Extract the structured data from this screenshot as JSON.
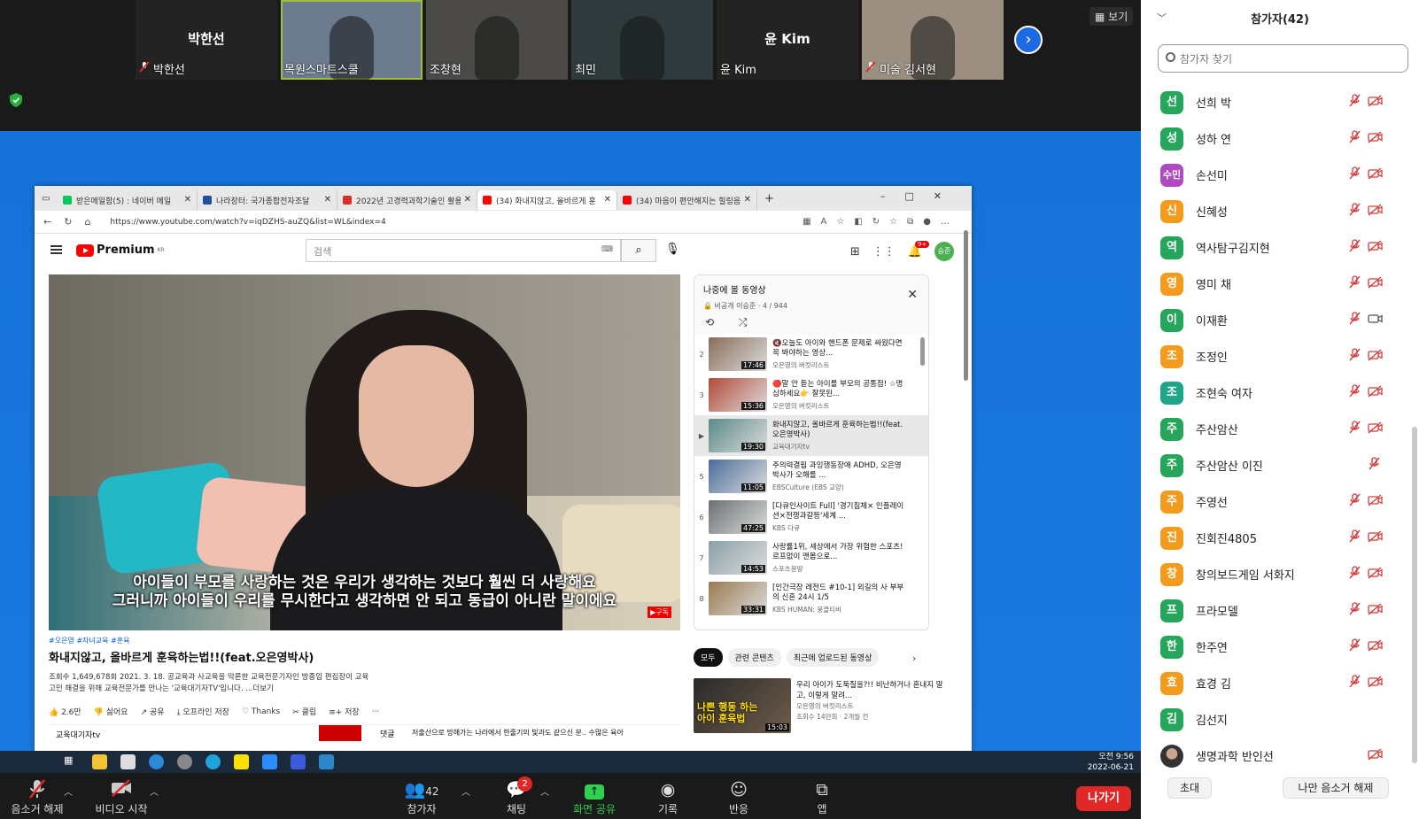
{
  "videos": [
    {
      "name": "박한선",
      "label": "박한선",
      "big": true,
      "mic_off": true,
      "bg": "#232323"
    },
    {
      "name": "목원스마트스쿨",
      "label": "목원스마트스쿨",
      "active": true,
      "bg": "#6c7b8e"
    },
    {
      "name": "조창현",
      "label": "조창현",
      "bg": "#4b4a48"
    },
    {
      "name": "최민",
      "label": "최민",
      "bg": "#2f3a3c"
    },
    {
      "name": "윤 Kim",
      "label": "윤 Kim",
      "big": true,
      "bg": "#232323"
    },
    {
      "name": "미술 김서현",
      "label": "미술 김서현",
      "mic_off": true,
      "bg": "#9a8f80"
    }
  ],
  "view_label": "보기",
  "next_icon": "chevron-right-icon",
  "browser": {
    "tabs": [
      {
        "title": "받은메일함(5) : 네이버 메일",
        "color": "#03c75a"
      },
      {
        "title": "나라장터: 국가종합전자조달",
        "color": "#1d4f9c"
      },
      {
        "title": "2022년 고경력과학기술인 활용",
        "color": "#d93025"
      },
      {
        "title": "(34) 화내지않고, 올바르게 훈",
        "color": "#ff0000",
        "active": true
      },
      {
        "title": "(34) 마음이 편안해지는 힐링음",
        "color": "#ff0000"
      }
    ],
    "new_tab": "+",
    "window_controls": "–□✕",
    "url": "https://www.youtube.com/watch?v=iqDZHS-auZQ&list=WL&index=4"
  },
  "youtube": {
    "logo": "Premium",
    "logo_region": "KR",
    "search_placeholder": "검색",
    "notif_count": "9+",
    "user_initial": "승준",
    "subtitle_line1": "아이들이 부모를 사랑하는 것은 우리가 생각하는 것보다 훨씬 더 사랑해요",
    "subtitle_line2": "그러니까 아이들이 우리를 무시한다고 생각하면 안 되고 동급이 아니란 말이에요",
    "sub_logo": "▶구독",
    "tags": "#오은영 #자녀교육 #훈육",
    "title": "화내지않고, 올바르게 훈육하는법!!(feat.오은영박사)",
    "meta_line1": "조회수 1,649,678회  2021. 3. 18.  공교육과 사교육을 막론한 교육전문기자인 방종임 편집장이 교육",
    "meta_line2": "고민 해결을 위해 교육전문가를 만나는 '교육대기자TV'입니다.   ...더보기",
    "actions": [
      "👍 2.6만",
      "👎 싫어요",
      "↗ 공유",
      "⤓ 오프라인 저장",
      "♡ Thanks",
      "✂ 클립",
      "≡+ 저장",
      "···"
    ],
    "channel": "교육대기자tv",
    "comment_label": "댓글",
    "comment_preview": "저출산으로 망해가는 나라에서 한줄기의 빛과도 같으신 분.. 수많은 육아",
    "playlist": {
      "title": "나중에 볼 동영상",
      "meta": "🔒 비공개   이승준 · 4 / 944",
      "controls": "⟲ ⤮",
      "items": [
        {
          "num": "2",
          "title": "🔇오늘도 아이와 핸드폰 문제로 싸웠다면 꼭 봐야하는 영상...",
          "channel": "오은영의 버킷리스트",
          "dur": "17:46",
          "color": "#8a6d5a"
        },
        {
          "num": "3",
          "title": "🔴말 안 듣는 아이를 부모의 공통점! ☆명심하세요👉 잘못된...",
          "channel": "오은영의 버킷리스트",
          "dur": "15:36",
          "color": "#b24a3a"
        },
        {
          "num": "▶",
          "title": "화내지않고, 올바르게 훈육하는법!!(feat.오은영박사)",
          "channel": "교육대기자tv",
          "dur": "19:30",
          "color": "#5a8a88",
          "cur": true
        },
        {
          "num": "5",
          "title": "주의력결핍 과잉행동장애 ADHD, 오은영 박사가 오해를 ...",
          "channel": "EBSCulture (EBS 교양)",
          "dur": "11:05",
          "color": "#4a6c9a"
        },
        {
          "num": "6",
          "title": "[다큐인사이트 Full] '경기침체× 인플레이션×전쟁과갈등'세계 ...",
          "channel": "KBS 다큐",
          "dur": "47:25",
          "color": "#6a7070"
        },
        {
          "num": "7",
          "title": "사랑률1위, 세상에서 가장 위험한 스포츠! 르프없이 맨몸으로...",
          "channel": "스포츠몽땅",
          "dur": "14:53",
          "color": "#8aa0a8"
        },
        {
          "num": "8",
          "title": "[인간극장 레전드 #10-1] 외길의 사 부부의 신혼 24시 1/5",
          "channel": "KBS HUMAN: 뭉클티비",
          "dur": "33:31",
          "color": "#9a7a50"
        }
      ]
    },
    "chips": [
      "모두",
      "관련 콘텐츠",
      "최근에 업로드된 동영상"
    ],
    "rec": {
      "title": "우리 아이가 도둑질을?!! 비난하거나 혼내지 말고, 이렇게 말려...",
      "channel": "오은영의 버킷리스트",
      "views": "조회수 14만회 · 2개월 전",
      "dur": "15:03",
      "thumb_text": "나쁜 행동 하는 아이 훈육법"
    }
  },
  "taskbar_clock": [
    "오전 9:56",
    "2022-06-21"
  ],
  "toolbar": {
    "mute": "음소거 해제",
    "video": "비디오 시작",
    "participants": "참가자",
    "participants_count": "42",
    "chat": "채팅",
    "chat_badge": "2",
    "share": "화면 공유",
    "record": "기록",
    "react": "반응",
    "apps": "앱",
    "leave": "나가기"
  },
  "panel": {
    "title": "참가자(42)",
    "search_placeholder": "참가자 찾기",
    "people": [
      {
        "initial": "선",
        "name": "선희 박",
        "color": "#26a65b",
        "video_on": false
      },
      {
        "initial": "성",
        "name": "성하 연",
        "color": "#26a65b",
        "video_on": false
      },
      {
        "initial": "수민",
        "name": "손선미",
        "color": "#b04ac0",
        "video_on": false
      },
      {
        "initial": "신",
        "name": "신혜성",
        "color": "#f29b1d",
        "video_on": false
      },
      {
        "initial": "역",
        "name": "역사탐구김지현",
        "color": "#26a65b",
        "video_on": false
      },
      {
        "initial": "영",
        "name": "영미 채",
        "color": "#f29b1d",
        "video_on": false
      },
      {
        "initial": "이",
        "name": "이재환",
        "color": "#26a65b",
        "video_on": true
      },
      {
        "initial": "조",
        "name": "조정인",
        "color": "#f29b1d",
        "video_on": false
      },
      {
        "initial": "조",
        "name": "조현숙 여자",
        "color": "#1fa58a",
        "video_on": false
      },
      {
        "initial": "주",
        "name": "주산암산",
        "color": "#26a65b",
        "video_on": false
      },
      {
        "initial": "주",
        "name": "주산암산 이진",
        "color": "#26a65b",
        "video_on": null
      },
      {
        "initial": "주",
        "name": "주영선",
        "color": "#f29b1d",
        "video_on": false
      },
      {
        "initial": "진",
        "name": "진회진4805",
        "color": "#f29b1d",
        "video_on": false
      },
      {
        "initial": "창",
        "name": "창의보드게임 서화지",
        "color": "#f29b1d",
        "video_on": false
      },
      {
        "initial": "프",
        "name": "프라모델",
        "color": "#26a65b",
        "video_on": false
      },
      {
        "initial": "한",
        "name": "한주연",
        "color": "#26a65b",
        "video_on": false
      },
      {
        "initial": "효",
        "name": "효경 김",
        "color": "#f29b1d",
        "video_on": false
      },
      {
        "initial": "김",
        "name": "김선지",
        "color": "#26a65b",
        "video_on": null,
        "no_mic": true
      },
      {
        "initial": "",
        "name": "생명과학 반인선",
        "color": "#777",
        "video_on": false,
        "no_mic": true,
        "photo": true
      }
    ],
    "invite": "초대",
    "unmute_me": "나만 음소거 해제"
  }
}
